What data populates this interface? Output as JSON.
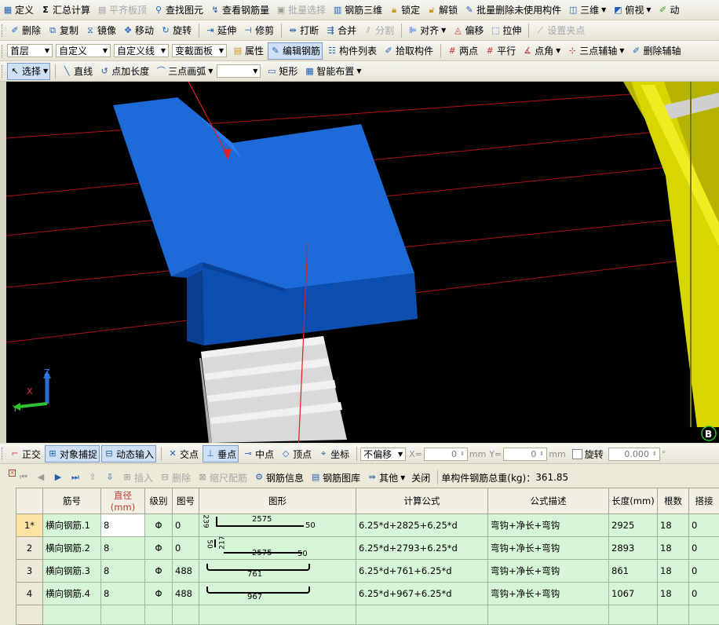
{
  "toolbar1": {
    "items": [
      {
        "label": "定义",
        "icon": "grid-icon"
      },
      {
        "label": "汇总计算",
        "icon": "sigma-icon"
      },
      {
        "label": "平齐板顶",
        "icon": "level-icon",
        "disabled": true
      },
      {
        "label": "查找图元",
        "icon": "binoculars-icon"
      },
      {
        "label": "查看钢筋量",
        "icon": "view-rebar-icon"
      },
      {
        "label": "批量选择",
        "icon": "batch-select-icon",
        "disabled": true
      },
      {
        "label": "钢筋三维",
        "icon": "rebar-3d-icon"
      },
      {
        "label": "锁定",
        "icon": "lock-icon"
      },
      {
        "label": "解锁",
        "icon": "unlock-icon"
      },
      {
        "label": "批量删除未使用构件",
        "icon": "brush-icon"
      },
      {
        "label": "三维",
        "icon": "cube-icon"
      },
      {
        "label": "俯视",
        "icon": "top-view-icon"
      },
      {
        "label": "动",
        "icon": "dynamic-icon"
      }
    ]
  },
  "toolbar2": {
    "items": [
      {
        "label": "删除"
      },
      {
        "label": "复制"
      },
      {
        "label": "镜像"
      },
      {
        "label": "移动"
      },
      {
        "label": "旋转"
      },
      {
        "label": "延伸"
      },
      {
        "label": "修剪"
      },
      {
        "label": "打断"
      },
      {
        "label": "合并"
      },
      {
        "label": "分割",
        "disabled": true
      },
      {
        "label": "对齐"
      },
      {
        "label": "偏移"
      },
      {
        "label": "拉伸"
      },
      {
        "label": "设置夹点",
        "disabled": true
      }
    ]
  },
  "toolbar3": {
    "floor": "首层",
    "category": "自定义",
    "subcategory": "自定义线",
    "component": "变截面板",
    "items": [
      {
        "label": "属性"
      },
      {
        "label": "编辑钢筋",
        "active": true
      },
      {
        "label": "构件列表"
      },
      {
        "label": "拾取构件"
      },
      {
        "label": "两点"
      },
      {
        "label": "平行"
      },
      {
        "label": "点角"
      },
      {
        "label": "三点辅轴"
      },
      {
        "label": "删除辅轴"
      }
    ]
  },
  "toolbar4": {
    "items": [
      {
        "label": "选择"
      },
      {
        "label": "直线"
      },
      {
        "label": "点加长度"
      },
      {
        "label": "三点画弧"
      },
      {
        "label": "矩形"
      },
      {
        "label": "智能布置"
      }
    ]
  },
  "snapbar": {
    "items": [
      {
        "label": "正交"
      },
      {
        "label": "对象捕捉"
      },
      {
        "label": "动态输入"
      },
      {
        "label": "交点"
      },
      {
        "label": "垂点"
      },
      {
        "label": "中点"
      },
      {
        "label": "顶点"
      },
      {
        "label": "坐标"
      }
    ],
    "offset_mode": "不偏移",
    "x_label": "X=",
    "x_value": "0",
    "x_unit": "mm",
    "y_label": "Y=",
    "y_value": "0",
    "y_unit": "mm",
    "rotate_label": "旋转",
    "rotate_value": "0.000",
    "rotate_unit": "°"
  },
  "rebarbar": {
    "items": [
      {
        "label": "插入",
        "disabled": true
      },
      {
        "label": "删除",
        "disabled": true
      },
      {
        "label": "缩尺配筋",
        "disabled": true
      },
      {
        "label": "钢筋信息"
      },
      {
        "label": "钢筋图库"
      },
      {
        "label": "其他"
      },
      {
        "label": "关闭"
      }
    ],
    "total_label": "单构件钢筋总重(kg)：",
    "total_value": "361.85"
  },
  "table": {
    "columns": [
      "",
      "筋号",
      "直径(mm)",
      "级别",
      "图号",
      "图形",
      "计算公式",
      "公式描述",
      "长度(mm)",
      "根数",
      "搭接"
    ],
    "rows": [
      {
        "rn": "1*",
        "name": "横向钢筋.1",
        "dia": "8",
        "grade": "Φ",
        "fig": "0",
        "shape": {
          "t1": "239",
          "t2": "",
          "mid": "2575",
          "end": "50"
        },
        "formula": "6.25*d+2825+6.25*d",
        "desc": "弯钩+净长+弯钩",
        "length": "2925",
        "count": "18",
        "lap": "0"
      },
      {
        "rn": "2",
        "name": "横向钢筋.2",
        "dia": "8",
        "grade": "Φ",
        "fig": "0",
        "shape": {
          "t1": "50",
          "t2": "217",
          "mid": "2575",
          "end": "50"
        },
        "formula": "6.25*d+2793+6.25*d",
        "desc": "弯钩+净长+弯钩",
        "length": "2893",
        "count": "18",
        "lap": "0"
      },
      {
        "rn": "3",
        "name": "横向钢筋.3",
        "dia": "8",
        "grade": "Φ",
        "fig": "488",
        "shape": {
          "mid": "761"
        },
        "formula": "6.25*d+761+6.25*d",
        "desc": "弯钩+净长+弯钩",
        "length": "861",
        "count": "18",
        "lap": "0"
      },
      {
        "rn": "4",
        "name": "横向钢筋.4",
        "dia": "8",
        "grade": "Φ",
        "fig": "488",
        "shape": {
          "mid": "967"
        },
        "formula": "6.25*d+967+6.25*d",
        "desc": "弯钩+净长+弯钩",
        "length": "1067",
        "count": "18",
        "lap": "0"
      }
    ]
  },
  "viewport": {
    "axis_labels": {
      "x": "X",
      "y": "Y",
      "z": "Z"
    },
    "corner_badge": "B"
  },
  "colors": {
    "slab": "#1c6bd8",
    "slab_dark": "#0c4fb0",
    "wall": "#dcdc00",
    "grid_line": "#cc1111",
    "annotation_arrow": "#e02020",
    "row_bg": "#d6f4d6"
  }
}
